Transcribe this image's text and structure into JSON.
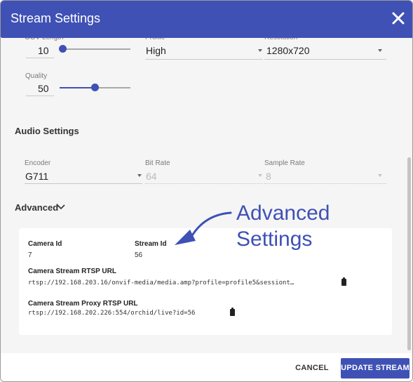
{
  "dialog": {
    "title": "Stream Settings",
    "close_icon": "close-icon"
  },
  "video": {
    "gov_length": {
      "label": "GOV Length",
      "value": "10",
      "slider_level": 0.05
    },
    "profile": {
      "label": "Profile",
      "value": "High"
    },
    "resolution": {
      "label": "Resolution",
      "value": "1280x720"
    },
    "quality": {
      "label": "Quality",
      "value": "50",
      "slider_level": 0.5
    }
  },
  "audio": {
    "section_title": "Audio Settings",
    "encoder": {
      "label": "Encoder",
      "value": "G711"
    },
    "bit_rate": {
      "label": "Bit Rate",
      "value": "64"
    },
    "sample_rate": {
      "label": "Sample Rate",
      "value": "8"
    }
  },
  "advanced": {
    "toggle_label": "Advanced",
    "chevron_icon": "chevron-down-icon",
    "camera_id": {
      "label": "Camera Id",
      "value": "7"
    },
    "stream_id": {
      "label": "Stream Id",
      "value": "56"
    },
    "rtsp_url": {
      "label": "Camera Stream RTSP URL",
      "value": "rtsp://192.168.203.16/onvif-media/media.amp?profile=profile5&sessiont…",
      "copy_icon": "clipboard-icon"
    },
    "proxy_rtsp_url": {
      "label": "Camera Stream Proxy RTSP URL",
      "value": "rtsp://192.168.202.226:554/orchid/live?id=56",
      "copy_icon": "clipboard-icon"
    }
  },
  "annotation": {
    "line1": "Advanced",
    "line2": "Settings",
    "color": "#3f51b5"
  },
  "footer": {
    "cancel_label": "CANCEL",
    "update_label": "UPDATE STREAM"
  },
  "colors": {
    "accent": "#3f51b5",
    "background": "#f5f5f5"
  }
}
